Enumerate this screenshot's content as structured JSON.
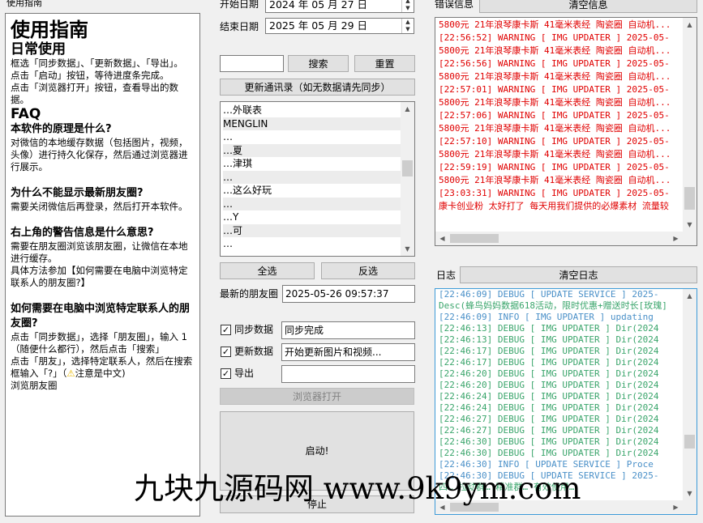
{
  "help": {
    "group_label": "使用指南",
    "title": "使用指南",
    "daily_heading": "日常使用",
    "daily_p1": "框选「同步数据」、「更新数据」、「导出」。",
    "daily_p2": "点击「启动」按钮，等待进度条完成。",
    "daily_p3": "点击「浏览器打开」按钮，查看导出的数据。",
    "faq_heading": "FAQ",
    "q1": "本软件的原理是什么?",
    "a1": "对微信的本地缓存数据（包括图片，视频，头像）进行持久化保存，然后通过浏览器进行展示。",
    "q2": "为什么不能显示最新朋友圈?",
    "a2": "需要关闭微信后再登录，然后打开本软件。",
    "q3": "右上角的警告信息是什么意思?",
    "a3": "需要在朋友圈浏览该朋友圈，让微信在本地进行缓存。",
    "a3b": "具体方法参加【如何需要在电脑中浏览特定联系人的朋友圈?】",
    "q4": "如何需要在电脑中浏览特定联系人的朋友圈?",
    "a4a": "点击「同步数据」，选择「朋友圈」，输入 1 （随便什么都行），然后点击「搜索」",
    "a4b": "点击「朋友」，选择特定联系人，然后在搜索框输入「?」（",
    "a4b_warn": "注意是中文)",
    "a4c": "浏览朋友圈"
  },
  "controls": {
    "start_date_label": "开始日期",
    "start_date": "2024 年 05 月 27 日",
    "end_date_label": "结束日期",
    "end_date": "2025 年 05 月 29 日",
    "search_value": "",
    "search_button": "搜索",
    "reset_button": "重置",
    "update_contacts_button": "更新通讯录（如无数据请先同步）",
    "contacts": [
      "…外联表",
      "MENGLIN",
      "…",
      "…夏",
      "…津琪",
      "…",
      "…这么好玩",
      "…",
      "…Y",
      "…可",
      "…"
    ],
    "select_all_button": "全选",
    "invert_button": "反选",
    "latest_label": "最新的朋友圈",
    "latest_value": "2025-05-26 09:57:37",
    "sync_label": "同步数据",
    "sync_status": "同步完成",
    "update_label": "更新数据",
    "update_status": "开始更新图片和视频...",
    "export_label": "导出",
    "export_status": "",
    "browser_button": "浏览器打开",
    "start_button": "启动!",
    "stop_button": "停止"
  },
  "errors": {
    "group_label": "错误信息",
    "clear_button": "清空信息",
    "lines": [
      "5800元 21年浪琴康卡斯 41毫米表经 陶瓷圈 自动机...",
      "[22:56:52] WARNING  [ IMG UPDATER ] 2025-05-",
      "5800元 21年浪琴康卡斯 41毫米表经 陶瓷圈 自动机...",
      "[22:56:56] WARNING  [ IMG UPDATER ] 2025-05-",
      "5800元 21年浪琴康卡斯 41毫米表经 陶瓷圈 自动机...",
      "[22:57:01] WARNING  [ IMG UPDATER ] 2025-05-",
      "5800元 21年浪琴康卡斯 41毫米表经 陶瓷圈 自动机...",
      "[22:57:06] WARNING  [ IMG UPDATER ] 2025-05-",
      "5800元 21年浪琴康卡斯 41毫米表经 陶瓷圈 自动机...",
      "[22:57:10] WARNING  [ IMG UPDATER ] 2025-05-",
      "5800元 21年浪琴康卡斯 41毫米表经 陶瓷圈 自动机...",
      "[22:59:19] WARNING  [ IMG UPDATER ] 2025-05-",
      "5800元 21年浪琴康卡斯 41毫米表经 陶瓷圈 自动机...",
      "[23:03:31] WARNING  [ IMG UPDATER ] 2025-05-",
      "康卡创业粉 太好打了 每天用我们提供的必爆素材 流量较"
    ]
  },
  "logs": {
    "group_label": "日志",
    "clear_button": "清空日志",
    "lines": [
      "[22:46:09] DEBUG    [ UPDATE SERVICE ] 2025-",
      "Desc(蜂鸟妈妈数据618活动，限时优惠+赠送时长[玫瑰] ",
      "[22:46:09] INFO     [ IMG UPDATER ] updating",
      "[22:46:13] DEBUG    [ IMG UPDATER ] Dir(2024",
      "[22:46:13] DEBUG    [ IMG UPDATER ] Dir(2024",
      "[22:46:17] DEBUG    [ IMG UPDATER ] Dir(2024",
      "[22:46:17] DEBUG    [ IMG UPDATER ] Dir(2024",
      "[22:46:20] DEBUG    [ IMG UPDATER ] Dir(2024",
      "[22:46:20] DEBUG    [ IMG UPDATER ] Dir(2024",
      "[22:46:24] DEBUG    [ IMG UPDATER ] Dir(2024",
      "[22:46:24] DEBUG    [ IMG UPDATER ] Dir(2024",
      "[22:46:27] DEBUG    [ IMG UPDATER ] Dir(2024",
      "[22:46:27] DEBUG    [ IMG UPDATER ] Dir(2024",
      "[22:46:30] DEBUG    [ IMG UPDATER ] Dir(2024",
      "[22:46:30] DEBUG    [ IMG UPDATER ] Dir(2024",
      "[22:46:30] INFO     [ UPDATE SERVICE ] Proce",
      "[22:46:30] DEBUG    [ UPDATE SERVICE ] 2025-",
      "四…   拉动群…   精准群…   有效使用…"
    ]
  },
  "watermark": "九块九源码网 www.9k9ym.com",
  "colors": {
    "error_text": "#e00000",
    "log_text": "#3aa56b",
    "log_info_text": "#4a90c8",
    "watermark": "#000000"
  }
}
